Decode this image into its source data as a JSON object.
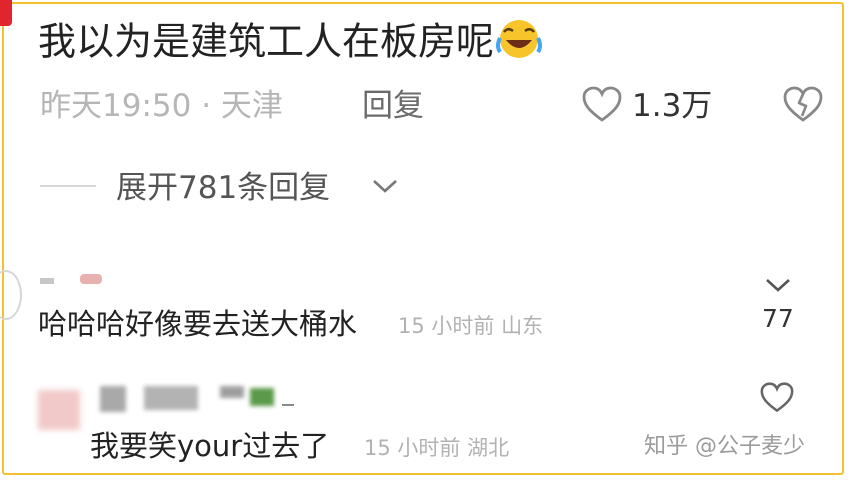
{
  "comment": {
    "text": "我以为是建筑工人在板房呢",
    "emoji": "rolling-on-floor-laughing-emoji",
    "meta": "昨天19:50 · 天津",
    "reply_label": "回复",
    "like_count": "1.3万",
    "expand_label": "展开781条回复"
  },
  "replies": [
    {
      "text": "哈哈哈好像要去送大桶水",
      "meta": "15 小时前 山东",
      "like_count": "77"
    },
    {
      "text": "我要笑your过去了",
      "meta": "15 小时前 湖北"
    }
  ],
  "watermark": "知乎 @公子麦少",
  "colors": {
    "border": "#f2c230",
    "corner_badge": "#e0262c"
  }
}
